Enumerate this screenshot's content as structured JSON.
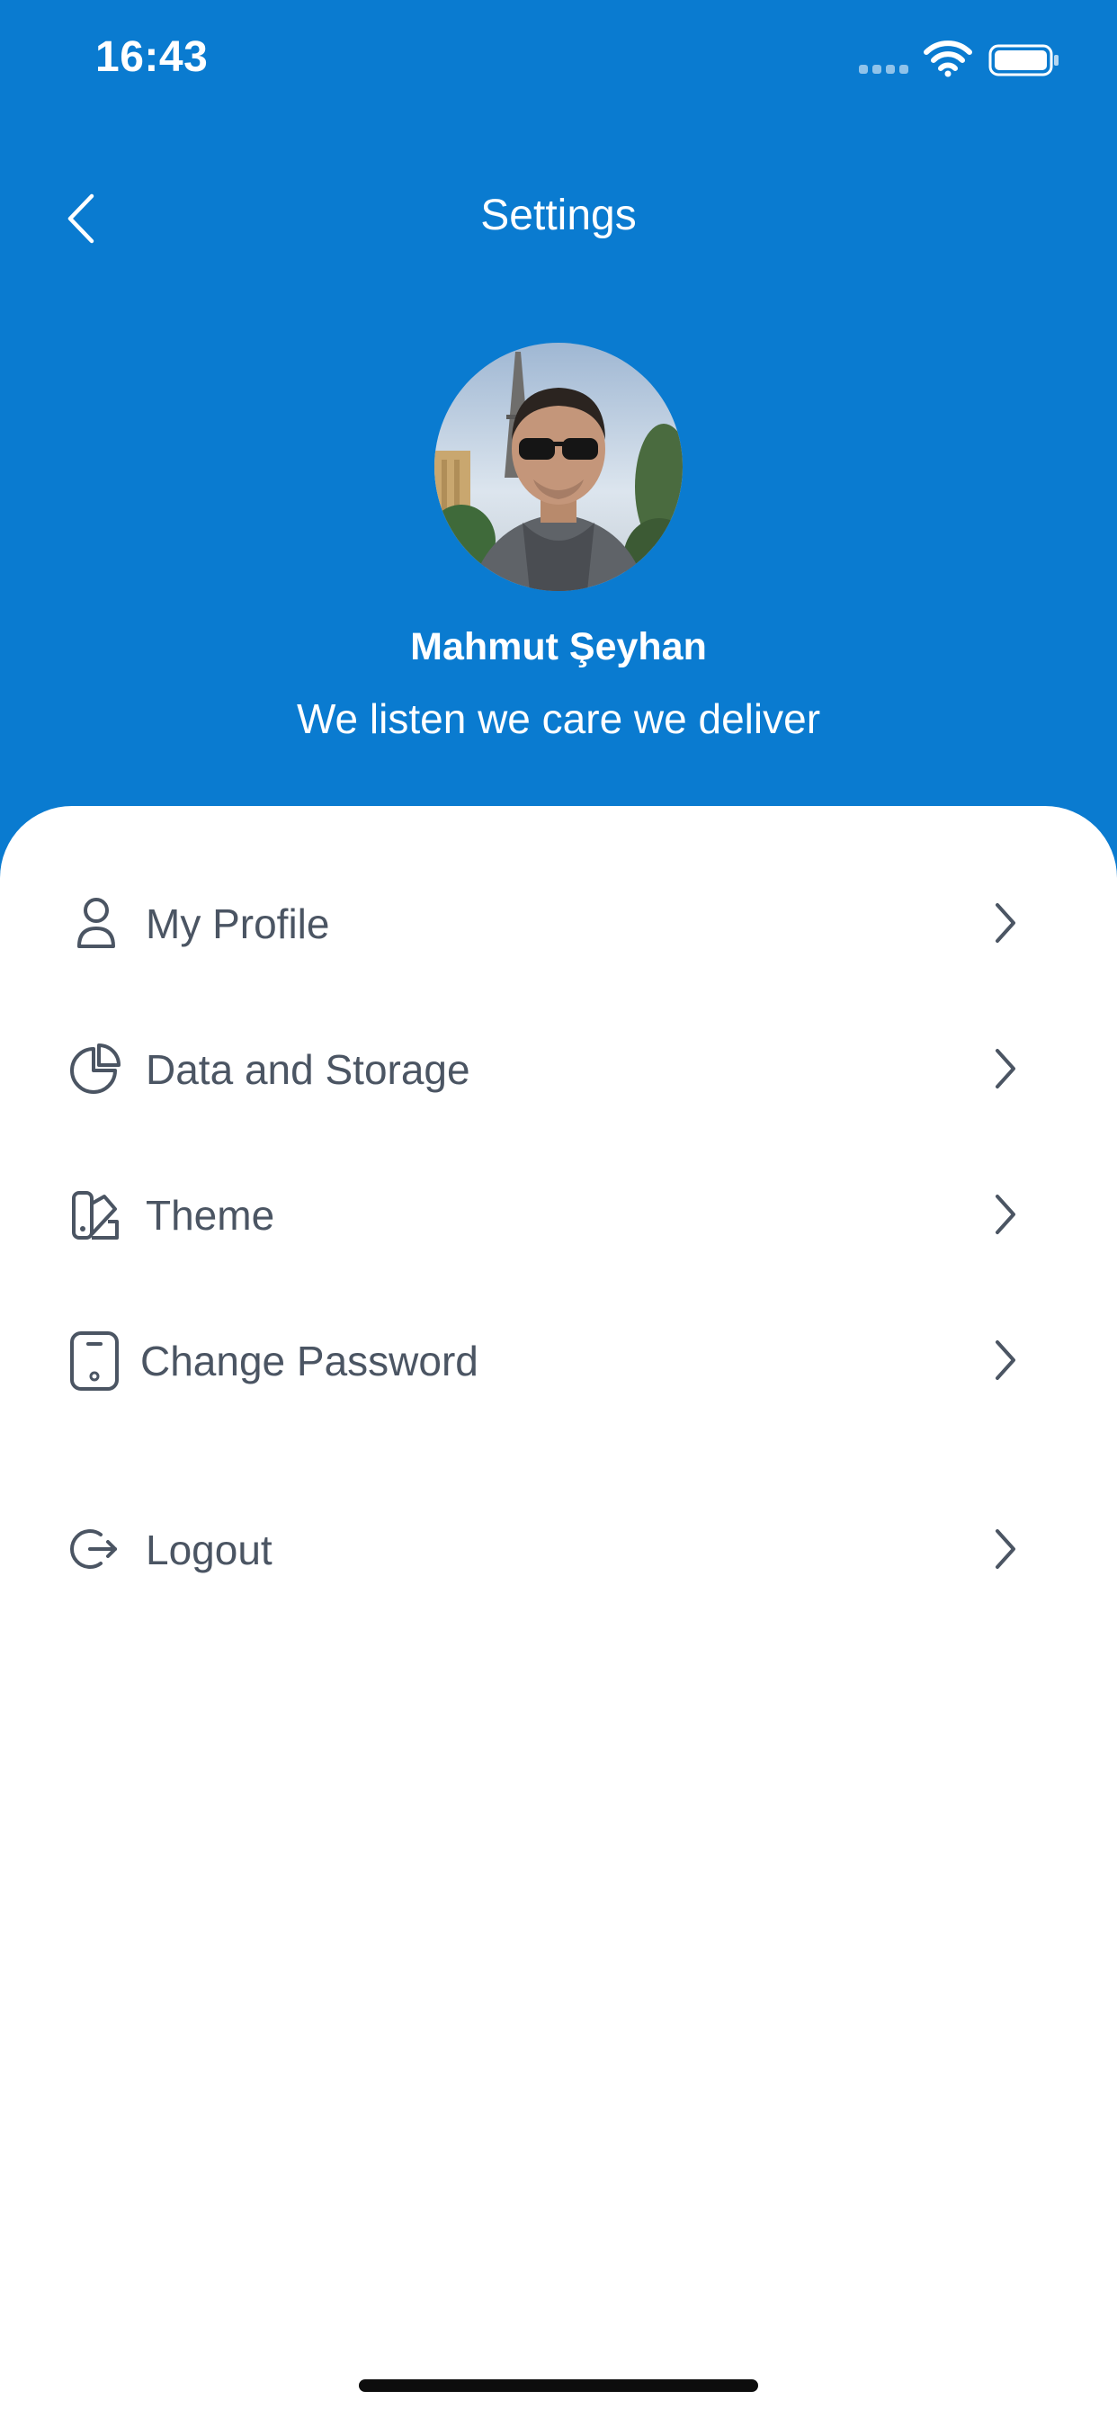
{
  "status_bar": {
    "time": "16:43"
  },
  "nav": {
    "title": "Settings"
  },
  "profile": {
    "name": "Mahmut Şeyhan",
    "tagline": "We listen we care we deliver"
  },
  "menu": [
    {
      "label": "My Profile",
      "icon": "user-icon"
    },
    {
      "label": "Data and Storage",
      "icon": "pie-chart-icon"
    },
    {
      "label": "Theme",
      "icon": "color-swatch-icon"
    },
    {
      "label": "Change Password",
      "icon": "mobile-device-icon"
    },
    {
      "label": "Logout",
      "icon": "logout-icon"
    }
  ],
  "colors": {
    "header_bg": "#0A7BD0",
    "card_bg": "#FFFFFF",
    "text_primary": "#4B5563",
    "header_text": "#FFFFFF"
  }
}
